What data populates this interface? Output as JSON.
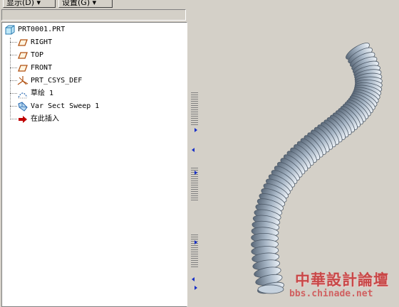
{
  "menu": {
    "display_label": "显示(D) ▾",
    "settings_label": "设置(G) ▾"
  },
  "tree": {
    "root": {
      "label": "PRT0001.PRT",
      "icon": "part-icon"
    },
    "items": [
      {
        "label": "RIGHT",
        "icon": "datum-plane-icon"
      },
      {
        "label": "TOP",
        "icon": "datum-plane-icon"
      },
      {
        "label": "FRONT",
        "icon": "datum-plane-icon"
      },
      {
        "label": "PRT_CSYS_DEF",
        "icon": "coordinate-system-icon"
      },
      {
        "label": "草绘 1",
        "icon": "sketch-icon"
      },
      {
        "label": "Var Sect Sweep 1",
        "icon": "sweep-icon"
      },
      {
        "label": "在此插入",
        "icon": "insert-here-arrow-icon"
      }
    ]
  },
  "viewport": {
    "model": "corrugated-tube-model",
    "tube_color": "#a9b8c8"
  },
  "watermark": {
    "title": "中華設計論壇",
    "url": "bbs.chinade.net"
  },
  "colors": {
    "background": "#d4d0c8",
    "tree_background": "#ffffff",
    "plane_icon": "#b05010",
    "insert_arrow": "#c00000",
    "splitter_arrow": "#1830c8"
  }
}
